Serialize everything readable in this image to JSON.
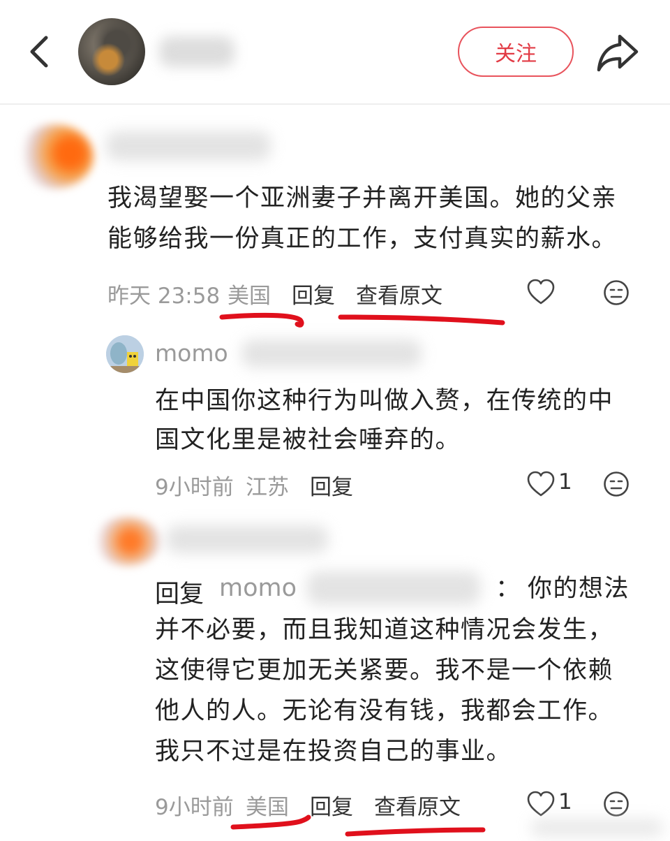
{
  "header": {
    "follow_label": "关注"
  },
  "comments": [
    {
      "text_lines": [
        "我渴望娶一个亚洲妻子并离开美国。她的父亲",
        "能够给我一份真正的工作，支付真实的薪水。"
      ],
      "time": "昨天 23:58",
      "location": "美国",
      "reply_label": "回复",
      "translate_label": "查看原文"
    },
    {
      "username": "momo",
      "text_lines": [
        "在中国你这种行为叫做入赘，在传统的中",
        "国文化里是被社会唾弃的。"
      ],
      "time": "9小时前",
      "location": "江苏",
      "reply_label": "回复",
      "like_count": "1"
    },
    {
      "reply_prefix": "回复",
      "reply_to": "momo",
      "reply_colon": "：",
      "first_line_tail": "你的想法",
      "text_lines": [
        "并不必要，而且我知道这种情况会发生，",
        "这使得它更加无关紧要。我不是一个依赖",
        "他人的人。无论有没有钱，我都会工作。",
        "我只不过是在投资自己的事业。"
      ],
      "time": "9小时前",
      "location": "美国",
      "reply_label": "回复",
      "translate_label": "查看原文",
      "like_count": "1"
    }
  ],
  "colors": {
    "accent_red": "#e23b45",
    "marker_red": "#e0101c"
  }
}
